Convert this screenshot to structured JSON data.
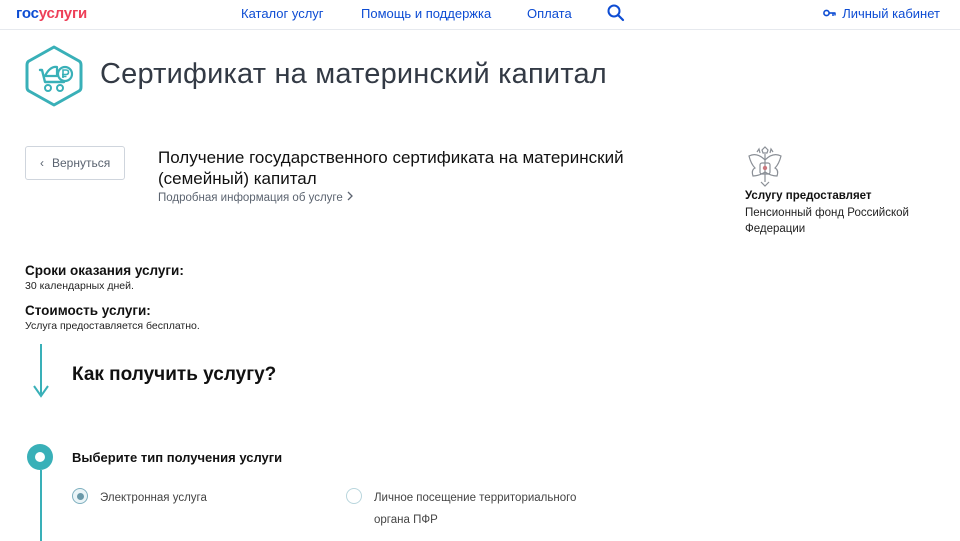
{
  "header": {
    "logo_part1": "гос",
    "logo_part2": "услуги",
    "nav": [
      "Каталог услуг",
      "Помощь и поддержка",
      "Оплата"
    ],
    "search_icon": "search-icon",
    "cabinet_label": "Личный кабинет",
    "cabinet_icon": "key-icon"
  },
  "page": {
    "title": "Сертификат на материнский капитал",
    "icon": "baby-stroller-ruble-icon",
    "accent_color": "#39b0b8"
  },
  "back_button": {
    "label": "Вернуться"
  },
  "service": {
    "title": "Получение государственного сертификата на материнский (семейный) капитал",
    "more_link": "Подробная информация об услуге"
  },
  "provider": {
    "label": "Услугу предоставляет",
    "name": "Пенсионный фонд Российской Федерации",
    "emblem": "russian-coat-of-arms-icon"
  },
  "info": {
    "terms_title": "Сроки оказания услуги:",
    "terms_value": "30 календарных дней.",
    "cost_title": "Стоимость услуги:",
    "cost_value": "Услуга предоставляется бесплатно."
  },
  "how": {
    "title": "Как получить услугу?"
  },
  "step1": {
    "title": "Выберите тип получения услуги",
    "options": [
      {
        "label": "Электронная услуга",
        "selected": true
      },
      {
        "label": "Личное посещение территориального органа ПФР",
        "selected": false
      }
    ]
  }
}
